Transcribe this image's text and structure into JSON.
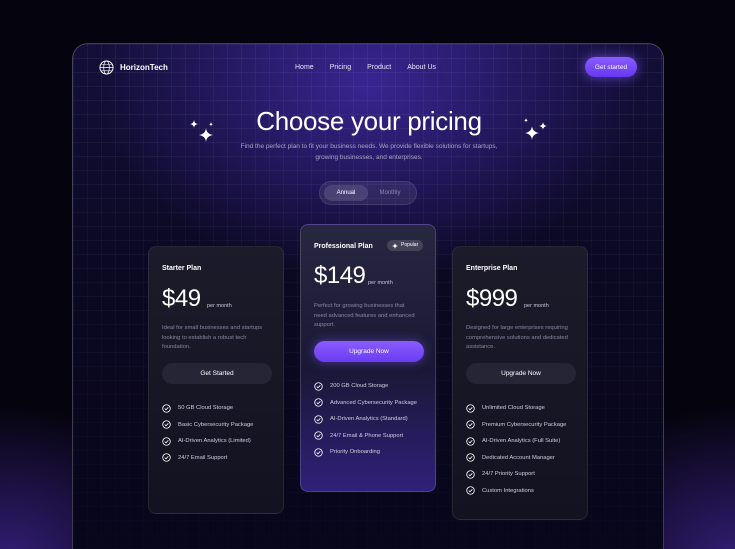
{
  "brand": {
    "name": "HorizonTech",
    "logo_icon": "globe-icon",
    "accent": "#7c4dff"
  },
  "nav": {
    "items": [
      "Home",
      "Pricing",
      "Product",
      "About Us"
    ]
  },
  "header": {
    "cta_label": "Get started"
  },
  "hero": {
    "title": "Choose your pricing",
    "subtitle_line1": "Find the perfect plan to fit your business needs. We provide flexible solutions for startups,",
    "subtitle_line2": "growing businesses, and enterprises."
  },
  "billing_toggle": {
    "options": [
      "Annual",
      "Monthly"
    ],
    "selected": "Annual"
  },
  "plans": [
    {
      "name": "Starter Plan",
      "price": "$49",
      "period": "per month",
      "description_lines": [
        "Ideal for small businesses and startups",
        "looking to establish a robust tech",
        "foundation."
      ],
      "button": "Get Started",
      "features": [
        "50 GB Cloud Storage",
        "Basic Cybersecurity Package",
        "AI-Driven Analytics (Limited)",
        "24/7 Email Support"
      ]
    },
    {
      "name": "Professional Plan",
      "badge": "Popular",
      "price": "$149",
      "period": "per month",
      "description_lines": [
        "Perfect for growing businesses that",
        "need advanced features and enhanced",
        "support."
      ],
      "button": "Upgrade Now",
      "features": [
        "200 GB Cloud Storage",
        "Advanced Cybersecurity Package",
        "AI-Driven Analytics (Standard)",
        "24/7 Email & Phone Support",
        "Priority Onboarding"
      ]
    },
    {
      "name": "Enterprise Plan",
      "price": "$999",
      "period": "per month",
      "description_lines": [
        "Designed for large enterprises requiring",
        "comprehensive solutions and dedicated",
        "assistance."
      ],
      "button": "Upgrade Now",
      "features": [
        "Unlimited Cloud Storage",
        "Premium Cybersecurity Package",
        "AI-Driven Analytics (Full Suite)",
        "Dedicated Account Manager",
        "24/7 Priority Support",
        "Custom Integrations"
      ]
    }
  ]
}
